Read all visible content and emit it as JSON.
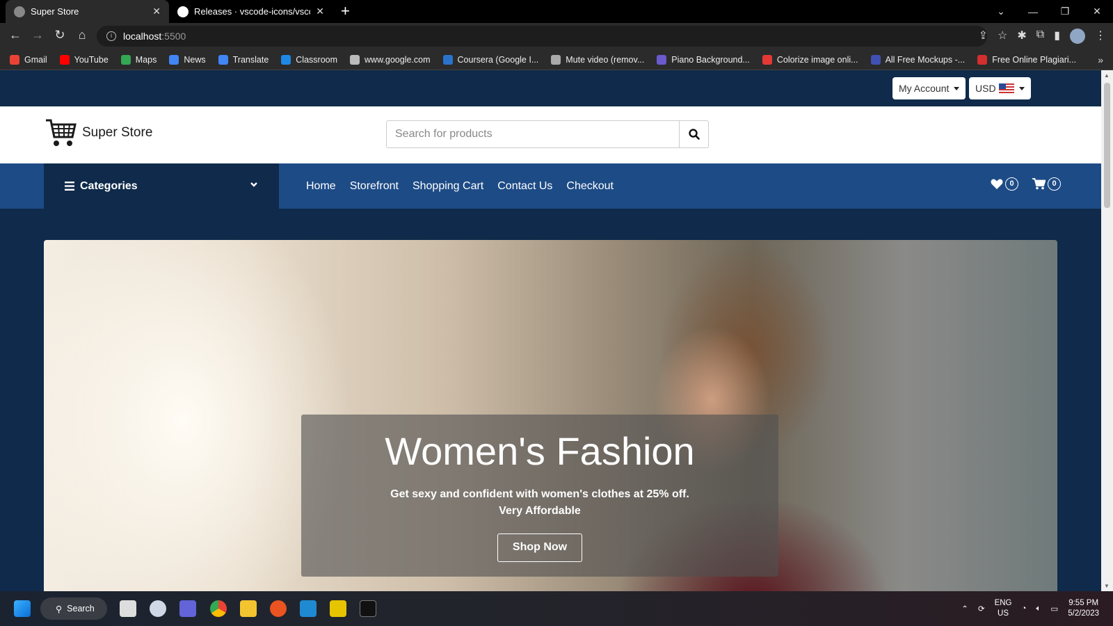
{
  "browser": {
    "tabs": [
      {
        "title": "Super Store",
        "active": true
      },
      {
        "title": "Releases · vscode-icons/vscode-i",
        "active": false
      }
    ],
    "url_host": "localhost",
    "url_port": ":5500",
    "bookmarks": [
      {
        "label": "Gmail",
        "color": "#ea4335"
      },
      {
        "label": "YouTube",
        "color": "#ff0000"
      },
      {
        "label": "Maps",
        "color": "#34a853"
      },
      {
        "label": "News",
        "color": "#4285f4"
      },
      {
        "label": "Translate",
        "color": "#4285f4"
      },
      {
        "label": "Classroom",
        "color": "#1e88e5"
      },
      {
        "label": "www.google.com",
        "color": "#bbbbbb"
      },
      {
        "label": "Coursera (Google I...",
        "color": "#2a73cc"
      },
      {
        "label": "Mute video (remov...",
        "color": "#aaaaaa"
      },
      {
        "label": "Piano Background...",
        "color": "#6a5acd"
      },
      {
        "label": "Colorize image onli...",
        "color": "#e53935"
      },
      {
        "label": "All Free Mockups -...",
        "color": "#3f51b5"
      },
      {
        "label": "Free Online Plagiari...",
        "color": "#d32f2f"
      }
    ]
  },
  "site": {
    "my_account_label": "My Account",
    "currency_label": "USD",
    "brand_name": "Super Store",
    "search_placeholder": "Search for products",
    "categories_label": "Categories",
    "nav_links": [
      "Home",
      "Storefront",
      "Shopping Cart",
      "Contact Us",
      "Checkout"
    ],
    "wishlist_count": "0",
    "cart_count": "0",
    "hero": {
      "title": "Women's Fashion",
      "subtitle": "Get sexy and confident with women's clothes at 25% off. Very Affordable",
      "button_label": "Shop Now"
    }
  },
  "taskbar": {
    "search_label": "Search",
    "language_line1": "ENG",
    "language_line2": "US",
    "time": "9:55 PM",
    "date": "5/2/2023"
  }
}
